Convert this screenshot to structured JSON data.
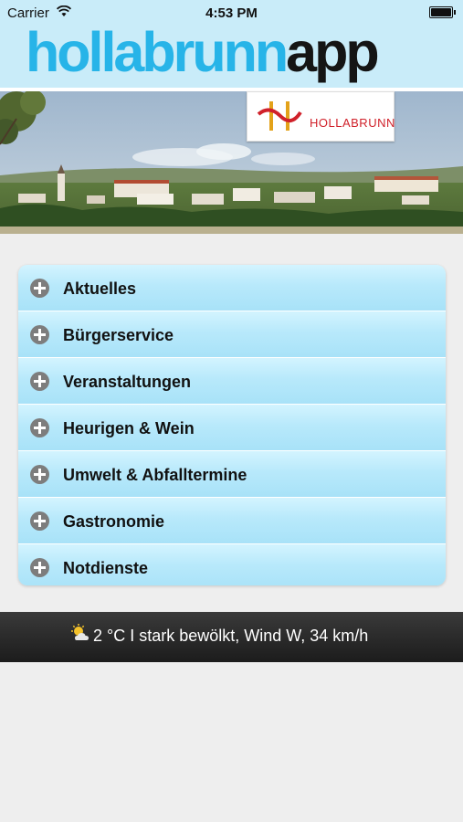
{
  "status_bar": {
    "carrier": "Carrier",
    "time": "4:53 PM"
  },
  "header": {
    "logo_part1": "hollabrunn",
    "logo_part2": "app"
  },
  "banner": {
    "badge_text": "HOLLABRUNN"
  },
  "menu": {
    "items": [
      {
        "label": "Aktuelles"
      },
      {
        "label": "Bürgerservice"
      },
      {
        "label": "Veranstaltungen"
      },
      {
        "label": "Heurigen & Wein"
      },
      {
        "label": "Umwelt & Abfalltermine"
      },
      {
        "label": "Gastronomie"
      },
      {
        "label": "Notdienste"
      }
    ]
  },
  "weather": {
    "text": "2 °C I stark bewölkt, Wind W, 34 km/h",
    "icon": "partly-cloudy-icon"
  },
  "colors": {
    "accent": "#27b4e8",
    "header_bg": "#c9ecf9",
    "menu_item": "#b8e9fb",
    "badge_red": "#d0212a"
  }
}
